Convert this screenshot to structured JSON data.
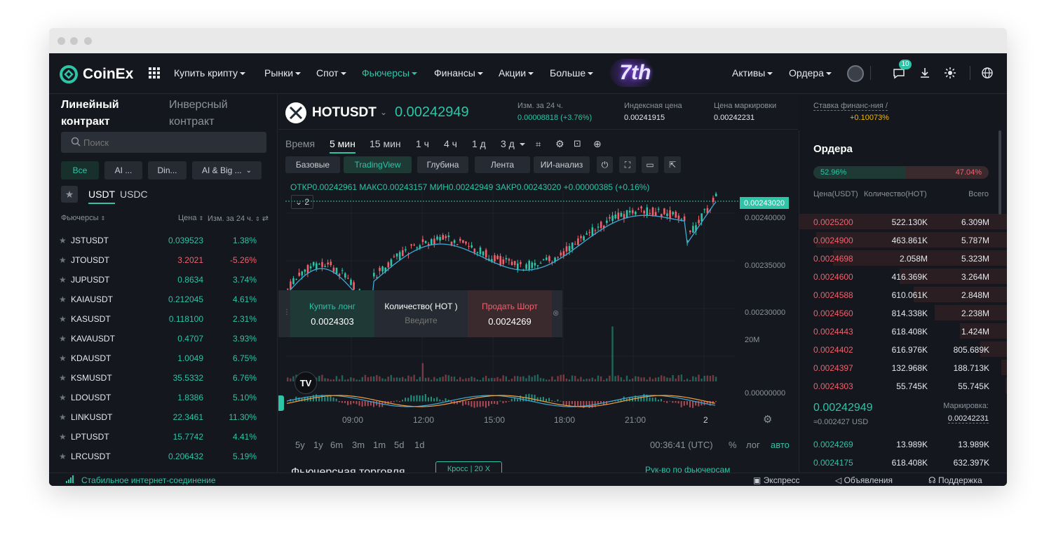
{
  "window": {
    "title": ""
  },
  "brand": {
    "name": "CoinEx",
    "accent": "#2ec4a7",
    "up": "#2ec4a7",
    "down": "#f0616d"
  },
  "nav": {
    "items": [
      {
        "label": "Купить крипту"
      },
      {
        "label": "Рынки"
      },
      {
        "label": "Спот"
      },
      {
        "label": "Фьючерсы"
      },
      {
        "label": "Финансы"
      },
      {
        "label": "Акции"
      },
      {
        "label": "Больше"
      }
    ],
    "promo": "7th",
    "right": {
      "assets": "Активы",
      "orders": "Ордера",
      "notif_count": "10"
    }
  },
  "left": {
    "tabs": [
      "Линейный контракт",
      "Инверсный контракт"
    ],
    "search_placeholder": "Поиск",
    "filters": [
      "Все",
      "AI ...",
      "Din...",
      "AI & Big ..."
    ],
    "quote_tabs": [
      "USDT",
      "USDC"
    ],
    "headers": {
      "name": "Фьючерсы",
      "price": "Цена",
      "change": "Изм. за 24 ч."
    },
    "rows": [
      {
        "sym": "JSTUSDT",
        "price": "0.039523",
        "chg": "1.38%",
        "dir": "up"
      },
      {
        "sym": "JTOUSDT",
        "price": "3.2021",
        "chg": "-5.26%",
        "dir": "down"
      },
      {
        "sym": "JUPUSDT",
        "price": "0.8634",
        "chg": "3.74%",
        "dir": "up"
      },
      {
        "sym": "KAIAUSDT",
        "price": "0.212045",
        "chg": "4.61%",
        "dir": "up"
      },
      {
        "sym": "KASUSDT",
        "price": "0.118100",
        "chg": "2.31%",
        "dir": "up"
      },
      {
        "sym": "KAVAUSDT",
        "price": "0.4707",
        "chg": "3.93%",
        "dir": "up"
      },
      {
        "sym": "KDAUSDT",
        "price": "1.0049",
        "chg": "6.75%",
        "dir": "up"
      },
      {
        "sym": "KSMUSDT",
        "price": "35.5332",
        "chg": "6.76%",
        "dir": "up"
      },
      {
        "sym": "LDOUSDT",
        "price": "1.8386",
        "chg": "5.10%",
        "dir": "up"
      },
      {
        "sym": "LINKUSDT",
        "price": "22.3461",
        "chg": "11.30%",
        "dir": "up"
      },
      {
        "sym": "LPTUSDT",
        "price": "15.7742",
        "chg": "4.41%",
        "dir": "up"
      },
      {
        "sym": "LRCUSDT",
        "price": "0.206432",
        "chg": "5.19%",
        "dir": "up"
      }
    ]
  },
  "ticker": {
    "symbol": "HOTUSDT",
    "price": "0.00242949",
    "chg_label": "Изм. за 24 ч.",
    "chg_value": "0.00008818 (+3.76%)",
    "index_label": "Индексная цена",
    "index_value": "0.00241915",
    "mark_label": "Цена маркировки",
    "mark_value": "0.00242231",
    "funding_label": "Ставка финанс-ния /",
    "funding_value": "+0.10073%"
  },
  "chart": {
    "intervals": [
      "Время",
      "5 мин",
      "15 мин",
      "1 ч",
      "4 ч",
      "1 д",
      "3 д"
    ],
    "views": [
      "Базовые",
      "TradingView",
      "Глубина",
      "Лента",
      "ИИ-анализ"
    ],
    "ohlc": "ОТКР0.00242961  МАКС0.00243157  МИН0.00242949  ЗАКР0.00243020  +0.00000385 (+0.16%)",
    "indicator_count": "2",
    "last_price_tag": "0.00243020",
    "y_ticks": [
      "0.00240000",
      "0.00235000",
      "0.00230000"
    ],
    "vol_tick": "20M",
    "macd_tick": "0.00000000",
    "x_ticks": [
      "09:00",
      "12:00",
      "15:00",
      "18:00",
      "21:00",
      "2"
    ],
    "ranges": [
      "5y",
      "1y",
      "6m",
      "3m",
      "1m",
      "5d",
      "1d"
    ],
    "clock": "00:36:41 (UTC)",
    "scale_opts": [
      "%",
      "лог",
      "авто"
    ],
    "quick_trade": {
      "buy_label": "Купить лонг",
      "buy_price": "0.0024303",
      "qty_label": "Количество( HOT )",
      "qty_placeholder": "Введите",
      "sell_label": "Продать Шорт",
      "sell_price": "0.0024269"
    },
    "bottom_left": "Фьючерсная торговля",
    "bottom_mid": "Кросс | 20 X",
    "bottom_right": "Рук-во по фьючерсам"
  },
  "orderbook": {
    "title": "Ордера",
    "buy_pct": "52.96%",
    "sell_pct": "47.04%",
    "buy_ratio": 0.5296,
    "headers": {
      "price": "Цена(USDT)",
      "qty": "Количество(HOT)",
      "total": "Всего"
    },
    "asks": [
      {
        "p": "0.0025200",
        "q": "522.130K",
        "t": "6.309M",
        "depth": 1.0
      },
      {
        "p": "0.0024900",
        "q": "463.861K",
        "t": "5.787M",
        "depth": 0.92
      },
      {
        "p": "0.0024698",
        "q": "2.058M",
        "t": "5.323M",
        "depth": 0.84
      },
      {
        "p": "0.0024600",
        "q": "416.369K",
        "t": "3.264M",
        "depth": 0.52
      },
      {
        "p": "0.0024588",
        "q": "610.061K",
        "t": "2.848M",
        "depth": 0.45
      },
      {
        "p": "0.0024560",
        "q": "814.338K",
        "t": "2.238M",
        "depth": 0.35
      },
      {
        "p": "0.0024443",
        "q": "618.408K",
        "t": "1.424M",
        "depth": 0.23
      },
      {
        "p": "0.0024402",
        "q": "616.976K",
        "t": "805.689K",
        "depth": 0.13
      },
      {
        "p": "0.0024397",
        "q": "132.968K",
        "t": "188.713K",
        "depth": 0.03
      },
      {
        "p": "0.0024303",
        "q": "55.745K",
        "t": "55.745K",
        "depth": 0.01
      }
    ],
    "last_price": "0.00242949",
    "last_usd": "≈0.002427  USD",
    "mark_label": "Маркировка:",
    "mark_value": "0.00242231",
    "bids": [
      {
        "p": "0.0024269",
        "q": "13.989K",
        "t": "13.989K"
      },
      {
        "p": "0.0024175",
        "q": "618.408K",
        "t": "632.397K"
      }
    ]
  },
  "status": {
    "connection": "Стабильное интернет-соединение",
    "express": "Экспресс",
    "announcements": "Объявления",
    "support": "Поддержка"
  }
}
